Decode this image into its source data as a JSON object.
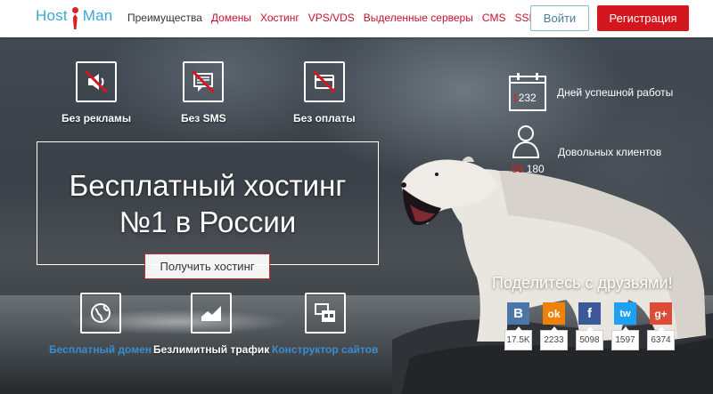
{
  "header": {
    "logo": {
      "part1": "Host",
      "part2": "Man"
    },
    "nav": [
      {
        "label": "Преимущества"
      },
      {
        "label": "Домены"
      },
      {
        "label": "Хостинг"
      },
      {
        "label": "VPS/VDS"
      },
      {
        "label": "Выделенные серверы"
      },
      {
        "label": "CMS"
      },
      {
        "label": "SSL"
      }
    ],
    "login_label": "Войти",
    "register_label": "Регистрация"
  },
  "features_top": [
    {
      "label": "Без рекламы",
      "icon": "no-ads-icon"
    },
    {
      "label": "Без SMS",
      "icon": "no-sms-icon"
    },
    {
      "label": "Без оплаты",
      "icon": "no-payment-icon"
    }
  ],
  "hero": {
    "title_line1": "Бесплатный хостинг",
    "title_line2": "№1 в России",
    "cta_label": "Получить хостинг"
  },
  "features_bottom": [
    {
      "label": "Бесплатный домен",
      "icon": "free-domain-icon"
    },
    {
      "label": "Безлимитный трафик",
      "icon": "unlimited-traffic-icon"
    },
    {
      "label": "Конструктор сайтов",
      "icon": "site-builder-icon"
    }
  ],
  "stats": {
    "days": {
      "red": "1",
      "white": "232",
      "label": "Дней успешной работы"
    },
    "clients": {
      "red": "88",
      "white": "180",
      "label": "Довольных клиентов"
    }
  },
  "share": {
    "title": "Поделитесь с друзьями!",
    "networks": [
      {
        "name": "vk",
        "glyph": "B",
        "count": "17.5K",
        "color": "#4a76a8"
      },
      {
        "name": "odnoklassniki",
        "glyph": "ok",
        "count": "2233",
        "color": "#ee8208"
      },
      {
        "name": "facebook",
        "glyph": "f",
        "count": "5098",
        "color": "#3b5998"
      },
      {
        "name": "twitter",
        "glyph": "tw",
        "count": "1597",
        "color": "#1da1f2"
      },
      {
        "name": "google-plus",
        "glyph": "g+",
        "count": "6374",
        "color": "#dd4b39"
      }
    ]
  },
  "colors": {
    "accent_red": "#d4161f",
    "logo_blue": "#3aa6d8",
    "link_blue": "#3a8cd0"
  }
}
